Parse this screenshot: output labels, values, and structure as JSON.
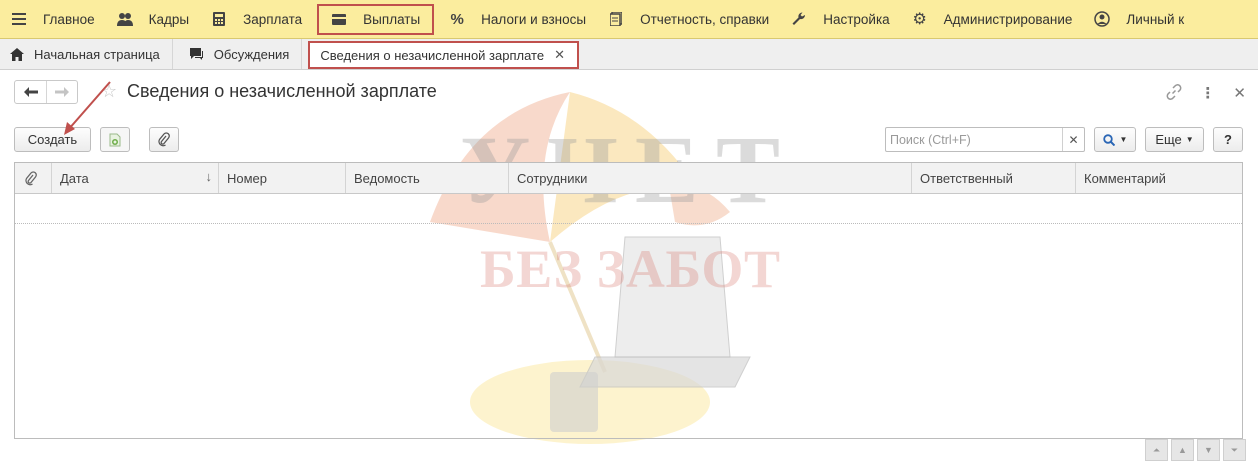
{
  "menu": {
    "items": [
      {
        "label": "Главное",
        "icon": "hamburger-icon"
      },
      {
        "label": "Кадры",
        "icon": "people-icon"
      },
      {
        "label": "Зарплата",
        "icon": "calculator-icon"
      },
      {
        "label": "Выплаты",
        "icon": "wallet-icon",
        "highlighted": true
      },
      {
        "label": "Налоги и взносы",
        "icon": "percent-icon"
      },
      {
        "label": "Отчетность, справки",
        "icon": "report-icon"
      },
      {
        "label": "Настройка",
        "icon": "wrench-icon"
      },
      {
        "label": "Администрирование",
        "icon": "gear-icon"
      },
      {
        "label": "Личный к",
        "icon": "user-circle-icon"
      }
    ]
  },
  "tabs": {
    "home": "Начальная страница",
    "discussions": "Обсуждения",
    "current": "Сведения о незачисленной зарплате"
  },
  "page": {
    "title": "Сведения о незачисленной зарплате"
  },
  "toolbar": {
    "create": "Создать",
    "search_placeholder": "Поиск (Ctrl+F)",
    "more": "Еще",
    "help": "?"
  },
  "table": {
    "columns": [
      "Дата",
      "Номер",
      "Ведомость",
      "Сотрудники",
      "Ответственный",
      "Комментарий"
    ]
  },
  "watermark": {
    "line1": "УЧЕТ",
    "line2": "БЕЗ ЗАБОТ"
  },
  "colors": {
    "menu_bg": "#fbed9e",
    "highlight": "#c0504d"
  }
}
